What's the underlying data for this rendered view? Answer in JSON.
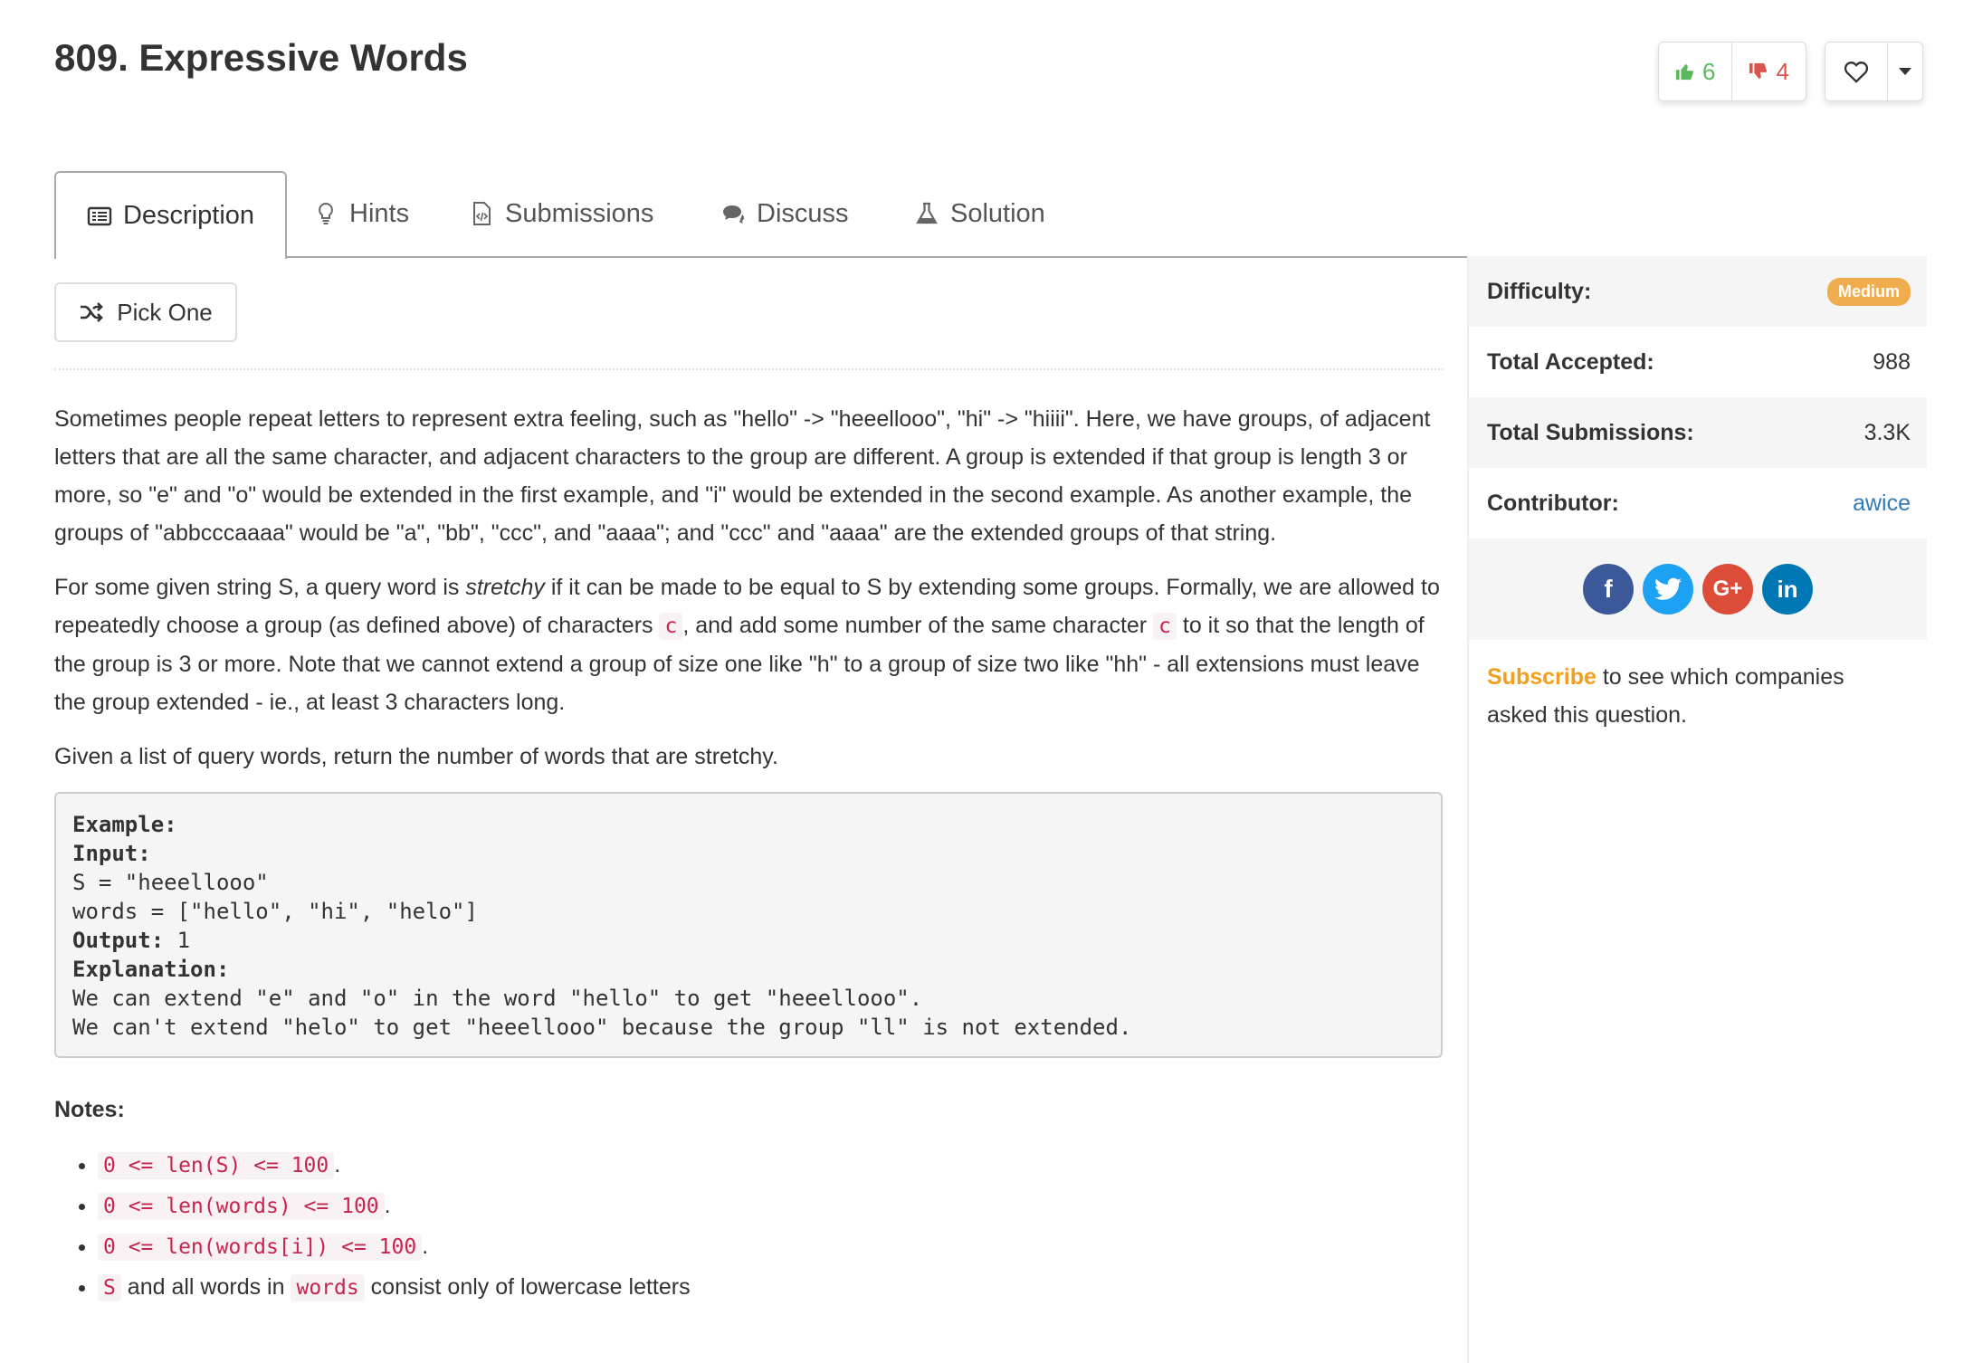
{
  "problem": {
    "title": "809. Expressive Words"
  },
  "votes": {
    "up": "6",
    "down": "4"
  },
  "tabs": [
    {
      "label": "Description",
      "icon": "list-icon"
    },
    {
      "label": "Hints",
      "icon": "lightbulb-icon"
    },
    {
      "label": "Submissions",
      "icon": "file-code-icon"
    },
    {
      "label": "Discuss",
      "icon": "comments-icon"
    },
    {
      "label": "Solution",
      "icon": "flask-icon"
    }
  ],
  "pick_one": "Pick One",
  "description": {
    "p1": "Sometimes people repeat letters to represent extra feeling, such as \"hello\" -> \"heeellooo\", \"hi\" -> \"hiiii\".  Here, we have groups, of adjacent letters that are all the same character, and adjacent characters to the group are different.  A group is extended if that group is length 3 or more, so \"e\" and \"o\" would be extended in the first example, and \"i\" would be extended in the second example.  As another example, the groups of \"abbcccaaaa\" would be \"a\", \"bb\", \"ccc\", and \"aaaa\"; and \"ccc\" and \"aaaa\" are the extended groups of that string.",
    "p2_a": "For some given string S, a query word is ",
    "p2_em": "stretchy",
    "p2_b": " if it can be made to be equal to S by extending some groups.  Formally, we are allowed to repeatedly choose a group (as defined above) of characters ",
    "p2_c1": "c",
    "p2_c": ", and add some number of the same character ",
    "p2_c2": "c",
    "p2_d": " to it so that the length of the group is 3 or more.  Note that we cannot extend a group of size one like \"h\" to a group of size two like \"hh\" - all extensions must leave the group extended - ie., at least 3 characters long.",
    "p3": "Given a list of query words, return the number of words that are stretchy."
  },
  "example": {
    "example_label": "Example:",
    "input_label": "Input:",
    "line_s": "S = \"heeellooo\"",
    "line_words": "words = [\"hello\", \"hi\", \"helo\"]",
    "output_label": "Output:",
    "output_value": " 1",
    "explanation_label": "Explanation:",
    "line_exp1": "We can extend \"e\" and \"o\" in the word \"hello\" to get \"heeellooo\".",
    "line_exp2": "We can't extend \"helo\" to get \"heeellooo\" because the group \"ll\" is not extended."
  },
  "notes": {
    "title": "Notes:",
    "n1_code": "0 <= len(S) <= 100",
    "n1_tail": ".",
    "n2_code": "0 <= len(words) <= 100",
    "n2_tail": ".",
    "n3_code": "0 <= len(words[i]) <= 100",
    "n3_tail": ".",
    "n4_code1": "S",
    "n4_mid": " and all words in ",
    "n4_code2": "words",
    "n4_tail": " consist only of lowercase letters"
  },
  "side": {
    "difficulty_label": "Difficulty:",
    "difficulty_value": "Medium",
    "accepted_label": "Total Accepted:",
    "accepted_value": "988",
    "submissions_label": "Total Submissions:",
    "submissions_value": "3.3K",
    "contributor_label": "Contributor:",
    "contributor_value": "awice",
    "share": [
      {
        "icon": "facebook-icon",
        "glyph": "f",
        "color": "#3b5998"
      },
      {
        "icon": "twitter-icon",
        "glyph": "t",
        "color": "#1da1f2"
      },
      {
        "icon": "google-plus-icon",
        "glyph": "G+",
        "color": "#dd4b39"
      },
      {
        "icon": "linkedin-icon",
        "glyph": "in",
        "color": "#0077b5"
      }
    ],
    "subscribe_link": "Subscribe",
    "subscribe_text": " to see which companies asked this question."
  },
  "colors": {
    "upvote": "#5cb85c",
    "downvote": "#d9534f",
    "medium_badge": "#f0ad4e",
    "link": "#337ab7",
    "subscribe": "#f0a01e"
  }
}
